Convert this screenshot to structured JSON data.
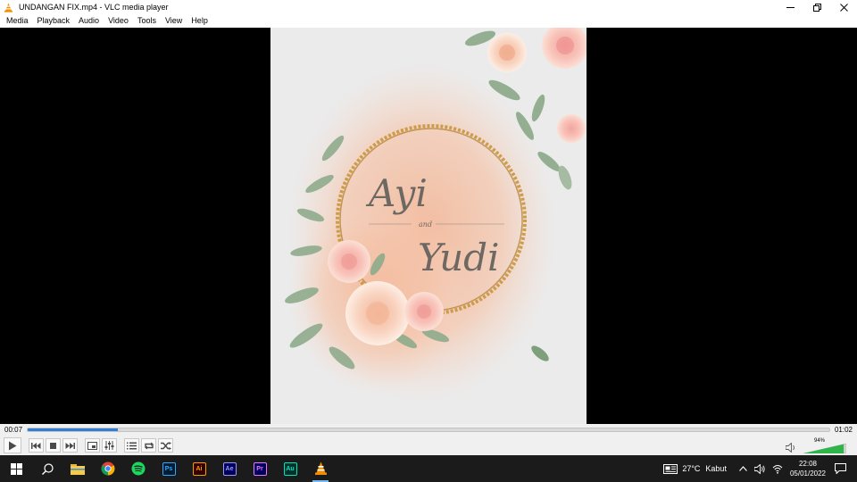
{
  "window": {
    "title": "UNDANGAN FIX.mp4 - VLC media player",
    "controls": {
      "minimize": "—",
      "restore": "❐",
      "close": "✕"
    }
  },
  "menu": [
    "Media",
    "Playback",
    "Audio",
    "Video",
    "Tools",
    "View",
    "Help"
  ],
  "video": {
    "names_line1": "Ayi",
    "names_and": "and",
    "names_line2": "Yudi"
  },
  "player": {
    "elapsed": "00:07",
    "total": "01:02",
    "progress_fraction": 0.113,
    "volume_percent": "94%",
    "volume_fraction": 0.94,
    "accent": "#2f7ed8"
  },
  "taskbar": {
    "apps": [
      {
        "name": "file-explorer-icon"
      },
      {
        "name": "chrome-icon"
      },
      {
        "name": "spotify-icon"
      },
      {
        "name": "photoshop-icon",
        "label": "Ps"
      },
      {
        "name": "illustrator-icon",
        "label": "Ai"
      },
      {
        "name": "after-effects-icon",
        "label": "Ae"
      },
      {
        "name": "premiere-icon",
        "label": "Pr"
      },
      {
        "name": "audition-icon",
        "label": "Au"
      },
      {
        "name": "vlc-icon"
      }
    ],
    "weather": {
      "temp": "27°C",
      "condition": "Kabut"
    },
    "time": "22:08",
    "date": "05/01/2022"
  }
}
